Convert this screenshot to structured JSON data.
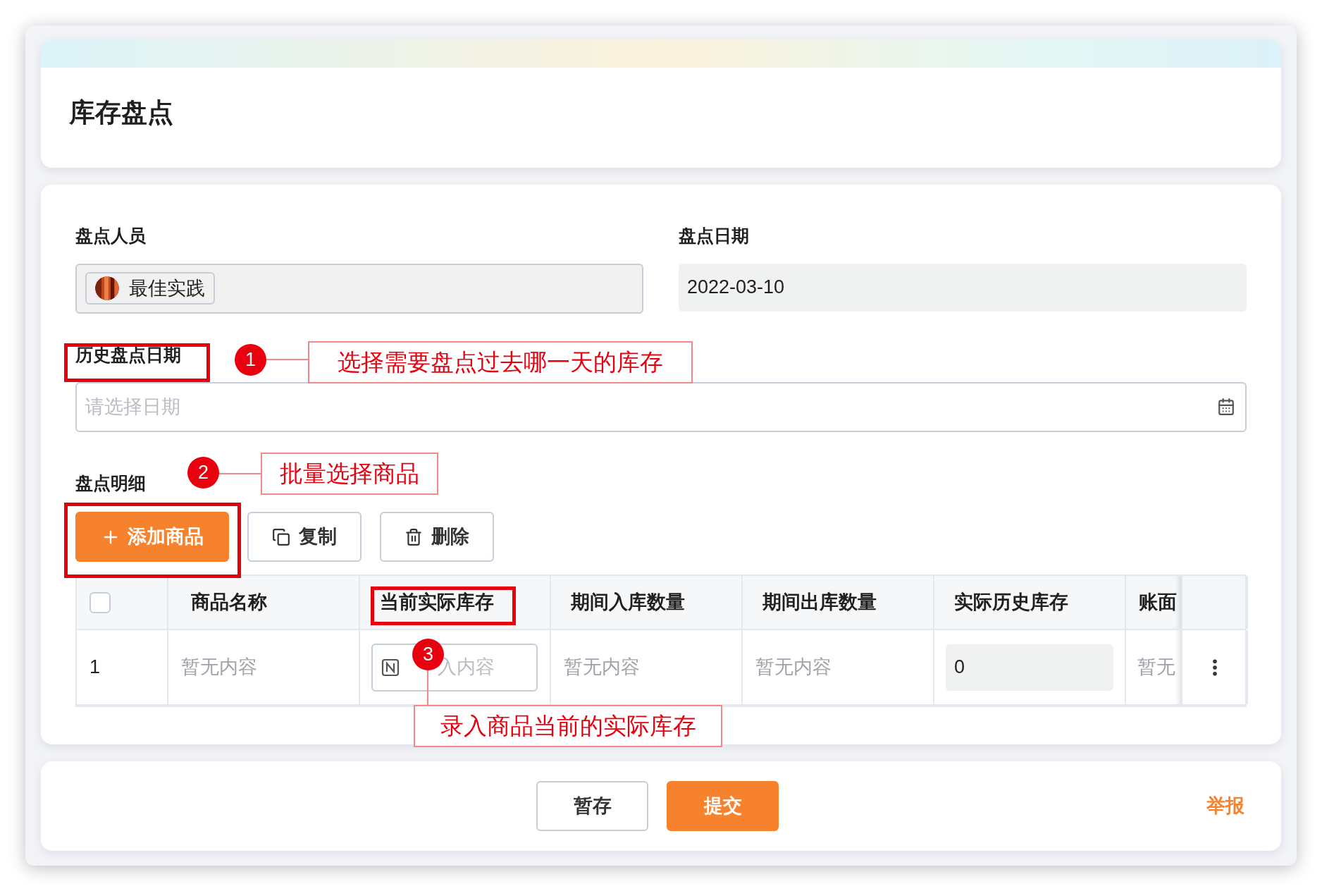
{
  "page_title": "库存盘点",
  "form": {
    "fields": [
      {
        "label": "盘点人员",
        "kind": "tag",
        "value": "最佳实践"
      },
      {
        "label": "盘点日期",
        "kind": "readonly",
        "value": "2022-03-10"
      }
    ],
    "history_date": {
      "label": "历史盘点日期",
      "placeholder": "请选择日期"
    }
  },
  "detail": {
    "label": "盘点明细",
    "buttons": [
      {
        "label": "添加商品",
        "kind": "primary"
      },
      {
        "label": "复制",
        "kind": "copy"
      },
      {
        "label": "删除",
        "kind": "delete"
      }
    ],
    "table": {
      "columns": [
        {
          "kind": "checkbox",
          "checked": false
        },
        {
          "kind": "text",
          "label": "商品名称"
        },
        {
          "kind": "text",
          "label": "当前实际库存"
        },
        {
          "kind": "text",
          "label": "期间入库数量"
        },
        {
          "kind": "text",
          "label": "期间出库数量"
        },
        {
          "kind": "text",
          "label": "实际历史库存"
        },
        {
          "kind": "text",
          "label": "账面"
        },
        {
          "kind": "actions"
        }
      ],
      "rows": [
        {
          "cells": [
            {
              "kind": "index",
              "text": "1"
            },
            {
              "kind": "empty",
              "text": "暂无内容"
            },
            {
              "kind": "input",
              "placeholder": "入内容"
            },
            {
              "kind": "empty",
              "text": "暂无内容"
            },
            {
              "kind": "empty",
              "text": "暂无内容"
            },
            {
              "kind": "readonly",
              "text": "0"
            },
            {
              "kind": "empty",
              "text": "暂无"
            },
            {
              "kind": "menu"
            }
          ]
        }
      ]
    }
  },
  "footer": {
    "buttons": [
      {
        "label": "暂存",
        "kind": "secondary"
      },
      {
        "label": "提交",
        "kind": "primary"
      }
    ],
    "link": "举报"
  },
  "annotations": [
    {
      "number": "1",
      "text": "选择需要盘点过去哪一天的库存"
    },
    {
      "number": "2",
      "text": "批量选择商品"
    },
    {
      "number": "3",
      "text": "录入商品当前的实际库存"
    }
  ]
}
